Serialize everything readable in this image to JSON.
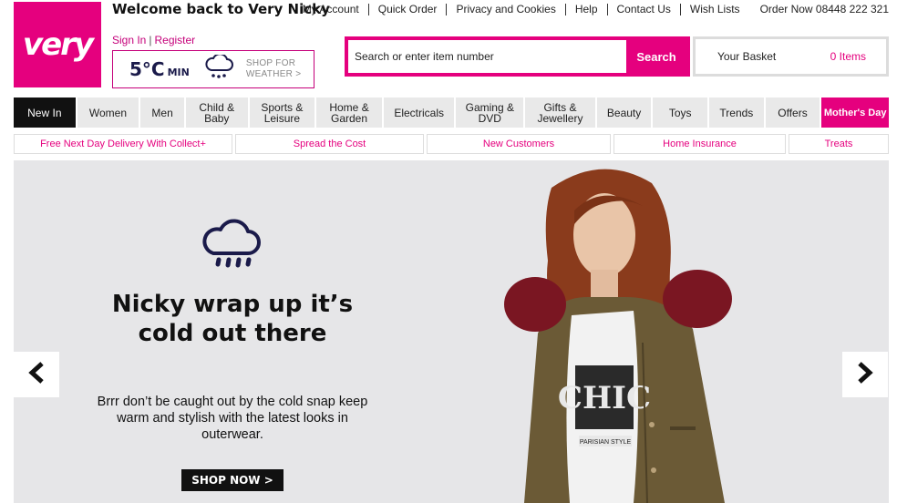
{
  "header": {
    "logo_text": "very",
    "welcome": "Welcome back to Very Nicky",
    "sign_in": "Sign In",
    "register": "Register",
    "separator": "|",
    "weather": {
      "temp": "5°C",
      "min_label": "MIN",
      "shop_line1": "SHOP FOR",
      "shop_line2": "WEATHER >"
    },
    "top_links": [
      "My Account",
      "Quick Order",
      "Privacy and Cookies",
      "Help",
      "Contact Us",
      "Wish Lists"
    ],
    "order_now": "Order Now 08448 222 321"
  },
  "search": {
    "placeholder": "Search or enter item number",
    "button": "Search"
  },
  "basket": {
    "label": "Your Basket",
    "items": "0 Items"
  },
  "nav": [
    "New In",
    "Women",
    "Men",
    "Child & Baby",
    "Sports & Leisure",
    "Home & Garden",
    "Electricals",
    "Gaming & DVD",
    "Gifts & Jewellery",
    "Beauty",
    "Toys",
    "Trends",
    "Offers",
    "Mother's Day"
  ],
  "promo": [
    "Free Next Day Delivery With Collect+",
    "Spread the Cost",
    "New Customers",
    "Home Insurance",
    "Treats"
  ],
  "hero": {
    "headline": "Nicky wrap up it’s cold out there",
    "body": "Brrr don’t be caught out by the cold snap keep warm and stylish with the latest looks in outerwear.",
    "cta": "SHOP NOW >",
    "model_shirt_text": "CHIC",
    "model_shirt_label": "PARISIAN STYLE"
  },
  "colors": {
    "brand": "#e5007e",
    "navy": "#1a1a4a"
  }
}
